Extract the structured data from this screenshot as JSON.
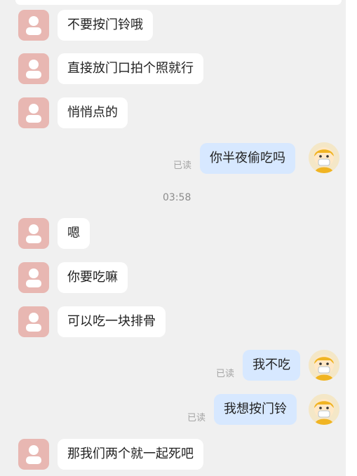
{
  "chat": {
    "time": "03:58",
    "read_label": "已读",
    "messages": [
      {
        "side": "in",
        "text": "不要按门铃哦"
      },
      {
        "side": "in",
        "text": "直接放门口拍个照就行"
      },
      {
        "side": "in",
        "text": "悄悄点的"
      },
      {
        "side": "out",
        "text": "你半夜偷吃吗",
        "status": "已读"
      },
      {
        "side": "in",
        "text": "嗯"
      },
      {
        "side": "in",
        "text": "你要吃嘛"
      },
      {
        "side": "in",
        "text": "可以吃一块排骨"
      },
      {
        "side": "out",
        "text": "我不吃",
        "status": "已读"
      },
      {
        "side": "out",
        "text": "我想按门铃",
        "status": "已读"
      },
      {
        "side": "in",
        "text": "那我们两个就一起死吧"
      }
    ]
  },
  "icons": {
    "other_avatar": "person-silhouette-icon",
    "self_avatar": "masked-cartoon-avatar-icon"
  },
  "colors": {
    "background": "#f0f0f0",
    "incoming_bubble": "#ffffff",
    "outgoing_bubble": "#d7e8ff",
    "other_avatar_bg": "#e8b7b2",
    "read_status": "#a5a5a5"
  }
}
